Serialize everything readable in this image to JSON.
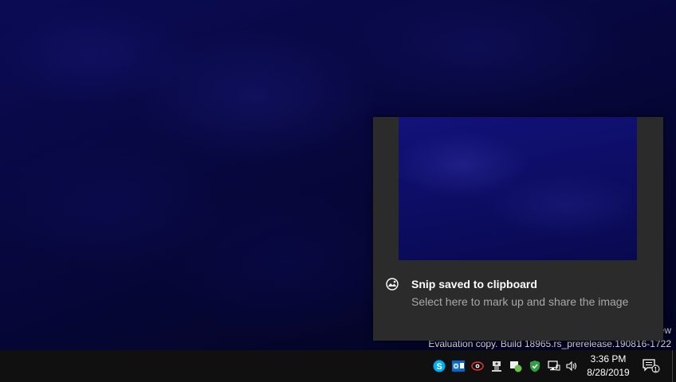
{
  "toast": {
    "title": "Snip saved to clipboard",
    "body": "Select here to mark up and share the image",
    "app_icon": "snip-sketch-icon"
  },
  "watermark": {
    "partial": "ew",
    "build": "Evaluation copy. Build 18965.rs_prerelease.190816-1722"
  },
  "taskbar": {
    "tray_icons": [
      "skype-icon",
      "outlook-icon",
      "eye-red-icon",
      "security-camera-icon",
      "onedrive-sync-icon",
      "windows-security-icon",
      "network-icon",
      "volume-icon"
    ],
    "time": "3:36 PM",
    "date": "8/28/2019",
    "notification_count": "1"
  },
  "colors": {
    "toast_bg": "#2b2b2b",
    "taskbar_bg": "#101010",
    "skype_blue": "#00aff0",
    "outlook_blue": "#0a64c8",
    "security_green": "#2ea043"
  }
}
